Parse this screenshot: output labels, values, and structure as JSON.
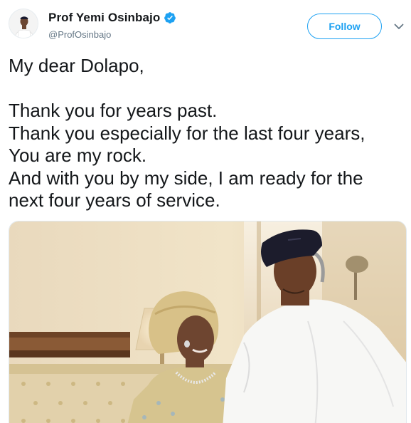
{
  "author": {
    "name": "Prof Yemi Osinbajo",
    "handle": "@ProfOsinbajo",
    "verified": true,
    "avatar_icon": "profile-photo-avatar"
  },
  "actions": {
    "follow_label": "Follow",
    "menu_icon": "chevron-down-icon"
  },
  "tweet": {
    "lines": [
      "My dear Dolapo,",
      "",
      "Thank you for years past.",
      "Thank you especially for the last four years,",
      "You are my rock.",
      "And with you by my side, I am ready for the",
      "next four years of service."
    ]
  },
  "media": {
    "type": "photo"
  },
  "colors": {
    "brand": "#1da1f2",
    "text": "#14171a",
    "secondary": "#657786"
  }
}
